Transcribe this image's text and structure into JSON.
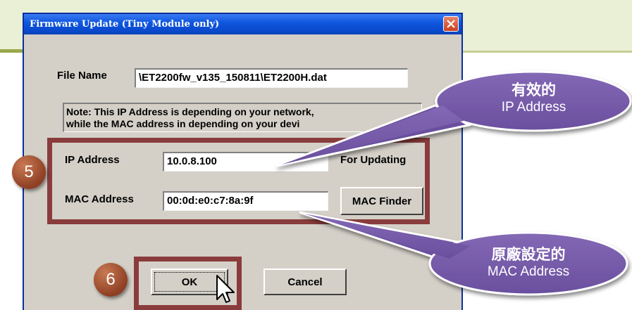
{
  "dialog": {
    "title": "Firmware Update (Tiny Module only)",
    "file_name_label": "File Name",
    "file_name_value": "\\ET2200fw_v135_150811\\ET2200H.dat",
    "note_line1": "Note: This IP Address is depending on your network,",
    "note_line2": "while the  MAC address in depending on your devi",
    "ip_label": "IP Address",
    "ip_value": "10.0.8.100",
    "for_updating_label": "For Updating",
    "mac_label": "MAC Address",
    "mac_value": "00:0d:e0:c7:8a:9f",
    "mac_finder_button": "MAC Finder",
    "ok_button": "OK",
    "cancel_button": "Cancel"
  },
  "annotations": {
    "step5": "5",
    "step6": "6",
    "callout_ip_line1": "有效的",
    "callout_ip_line2": "IP Address",
    "callout_mac_line1": "原廠設定的",
    "callout_mac_line2": "MAC Address"
  },
  "colors": {
    "titlebar": "#0a4bd0",
    "dialog_bg": "#d4d0c8",
    "highlight": "#8a3c3c",
    "callout": "#7458a6",
    "step_circle": "#a04f30"
  },
  "icons": {
    "close": "close-icon",
    "cursor": "mouse-pointer-icon"
  }
}
